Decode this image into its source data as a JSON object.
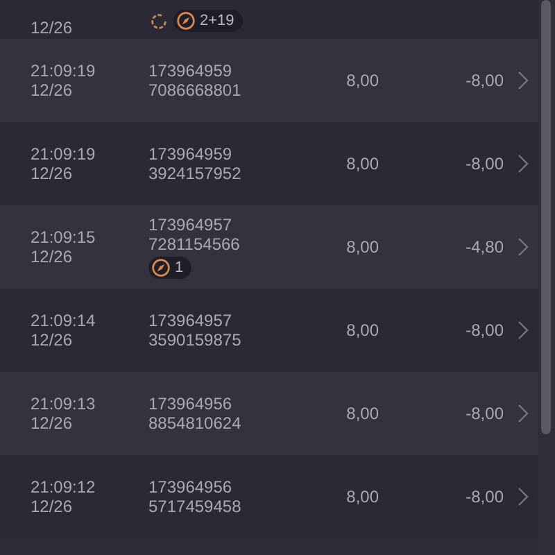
{
  "rows": [
    {
      "date": "12/26",
      "badges": [
        {
          "kind": "cycle"
        },
        {
          "kind": "pill",
          "text": "2+19"
        }
      ]
    },
    {
      "time": "21:09:19",
      "date": "12/26",
      "id_lines": [
        "173964959",
        "7086668801"
      ],
      "amount": "8,00",
      "payout": "-8,00"
    },
    {
      "time": "21:09:19",
      "date": "12/26",
      "id_lines": [
        "173964959",
        "3924157952"
      ],
      "amount": "8,00",
      "payout": "-8,00"
    },
    {
      "time": "21:09:15",
      "date": "12/26",
      "id_lines": [
        "173964957",
        "7281154566"
      ],
      "badges": [
        {
          "kind": "pill",
          "text": "1"
        }
      ],
      "amount": "8,00",
      "payout": "-4,80"
    },
    {
      "time": "21:09:14",
      "date": "12/26",
      "id_lines": [
        "173964957",
        "3590159875"
      ],
      "amount": "8,00",
      "payout": "-8,00"
    },
    {
      "time": "21:09:13",
      "date": "12/26",
      "id_lines": [
        "173964956",
        "8854810624"
      ],
      "amount": "8,00",
      "payout": "-8,00"
    },
    {
      "time": "21:09:12",
      "date": "12/26",
      "id_lines": [
        "173964956",
        "5717459458"
      ],
      "amount": "8,00",
      "payout": "-8,00"
    }
  ]
}
